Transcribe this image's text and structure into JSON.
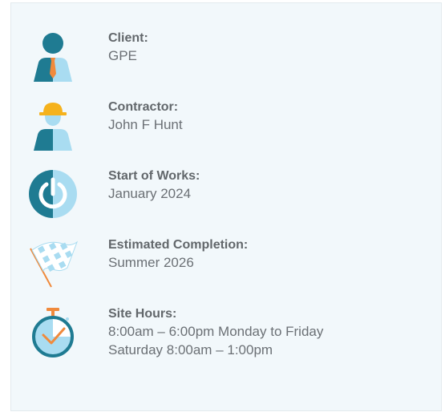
{
  "items": [
    {
      "icon": "client-icon",
      "label": "Client:",
      "lines": [
        "GPE"
      ]
    },
    {
      "icon": "contractor-icon",
      "label": "Contractor:",
      "lines": [
        "John F Hunt"
      ]
    },
    {
      "icon": "power-icon",
      "label": "Start of Works:",
      "lines": [
        "January 2024"
      ]
    },
    {
      "icon": "checkered-flag-icon",
      "label": "Estimated Completion:",
      "lines": [
        "Summer 2026"
      ]
    },
    {
      "icon": "stopwatch-icon",
      "label": "Site Hours:",
      "lines": [
        "8:00am – 6:00pm Monday to Friday",
        "Saturday 8:00am – 1:00pm"
      ]
    }
  ],
  "colors": {
    "dark_teal": "#1f7b92",
    "light_blue": "#a9dcf1",
    "orange": "#f08a3c",
    "yellow": "#f5b21c",
    "card_bg": "#f2f8fb"
  }
}
